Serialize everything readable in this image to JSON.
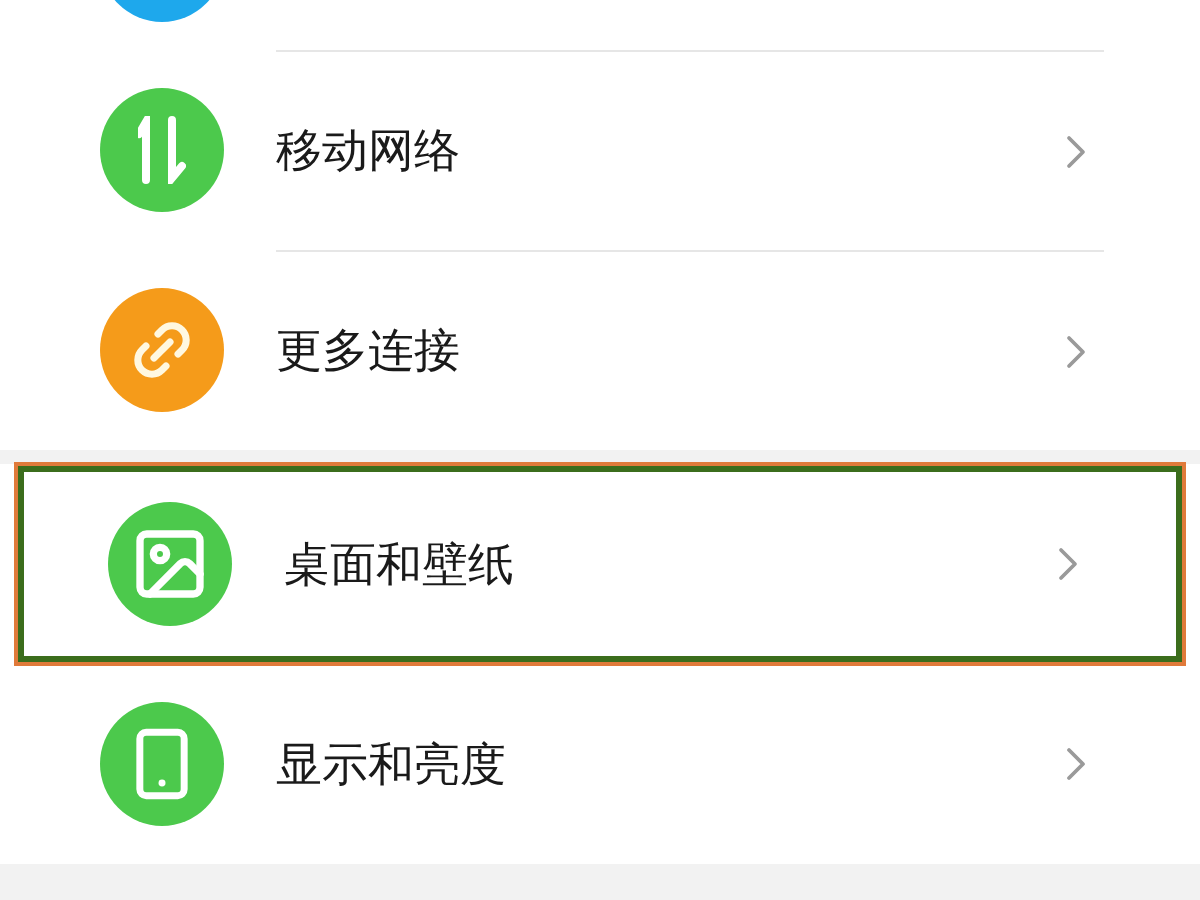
{
  "top_item": {
    "color": "#1ea8ec"
  },
  "groups": [
    {
      "items": [
        {
          "kind": "mobile-data",
          "label": "移动网络",
          "color": "#4cc94c",
          "highlighted": false
        },
        {
          "kind": "link",
          "label": "更多连接",
          "color": "#f59b1a",
          "highlighted": false
        }
      ]
    },
    {
      "items": [
        {
          "kind": "image",
          "label": "桌面和壁纸",
          "color": "#4cc94c",
          "highlighted": true
        },
        {
          "kind": "display",
          "label": "显示和亮度",
          "color": "#4cc94c",
          "highlighted": false
        }
      ]
    }
  ]
}
